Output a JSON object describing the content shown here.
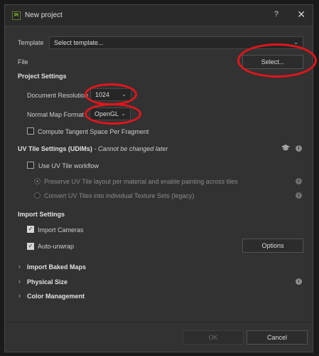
{
  "window": {
    "app_icon": "Pt",
    "title": "New project",
    "help": "?",
    "close": "✕"
  },
  "template": {
    "label": "Template",
    "value": "Select template..."
  },
  "file": {
    "label": "File",
    "button": "Select..."
  },
  "project_settings": {
    "title": "Project Settings",
    "resolution_label": "Document Resolution",
    "resolution_value": "1024",
    "normal_map_label": "Normal Map Format",
    "normal_map_value": "OpenGL",
    "tangent_label": "Compute Tangent Space Per Fragment",
    "tangent_checked": false
  },
  "uv_tile": {
    "title": "UV Tile Settings (UDIMs)",
    "note": " - Cannot be changed later",
    "workflow_label": "Use UV Tile workflow",
    "workflow_checked": false,
    "option_preserve": "Preserve UV Tile layout per material and enable painting across tiles",
    "option_convert": "Convert UV Tiles into individual Texture Sets (legacy)"
  },
  "import_settings": {
    "title": "Import Settings",
    "cameras_label": "Import Cameras",
    "cameras_checked": true,
    "autounwrap_label": "Auto-unwrap",
    "autounwrap_checked": true,
    "options_button": "Options"
  },
  "collapsibles": [
    {
      "label": "Import Baked Maps"
    },
    {
      "label": "Physical Size"
    },
    {
      "label": "Color Management"
    }
  ],
  "footer": {
    "ok": "OK",
    "cancel": "Cancel"
  },
  "icons": {
    "info": "i",
    "chevron": "⌄",
    "caret": "›",
    "check": "✓"
  },
  "colors": {
    "window_bg": "#323232",
    "annotation_red": "#e3151b",
    "brand_green": "#a6d93a"
  }
}
